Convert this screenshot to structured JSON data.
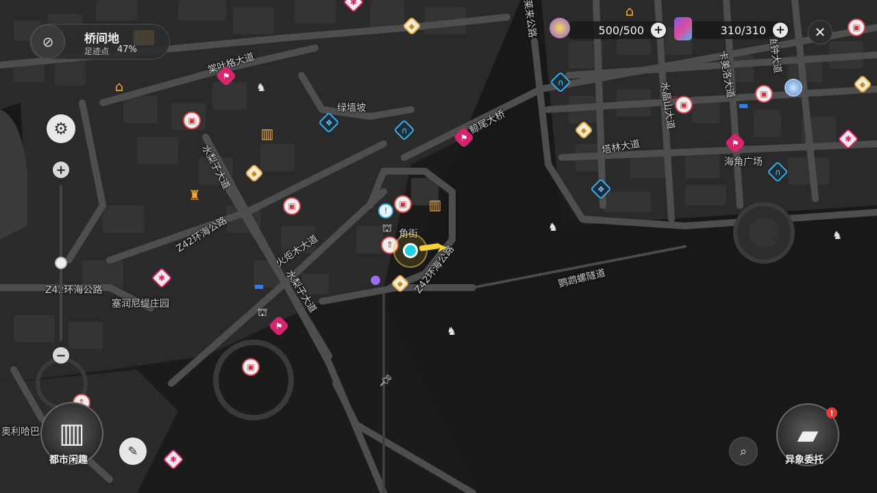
{
  "hud": {
    "area_name": "桥间地",
    "footprint_label": "足迹点",
    "footprint_value": "47%",
    "stamina": "500/500",
    "cards": "310/310"
  },
  "map_labels": {
    "ye_ge_avenue": "棠叶格大道",
    "luqiang_slope": "绿墙坡",
    "weibo_bridge": "鲸尾大桥",
    "shuili_avenue": "水梨子大道",
    "z42_highway_a": "Z42环海公路",
    "huoju_avenue": "火炬木大道",
    "angle_street": "角街",
    "shuili_avenue_b": "水梨子大道",
    "z42_highway_b": "Z42环海公路",
    "z42_highway_c": "Z42环海公路",
    "sairun_manor": "塞润尼缇庄园",
    "parrot_tunnel": "鹦鹉螺隧道",
    "talin_avenue": "塔林大道",
    "haijiao_plaza": "海角广场",
    "kamei_avenue": "卡美洛大道",
    "shuijing_avenue": "水晶山大道",
    "yuzhong_avenue": "鱼钟大道",
    "lai_road": "莱来公路",
    "aolihabar": "奥利哈巴"
  },
  "buttons": {
    "city_leisure": "都市闲趣",
    "anomaly_commission": "异象委托",
    "commission_badge": "!"
  },
  "colors": {
    "map_bg": "#1b1b1b",
    "road": "#4e4e4e",
    "block": "#2b2b2b",
    "accent_red": "#d6474f",
    "accent_pink": "#d8236f",
    "accent_blue": "#3ab0e6",
    "accent_gold": "#d9a53a"
  },
  "zoom_level": 0.5
}
